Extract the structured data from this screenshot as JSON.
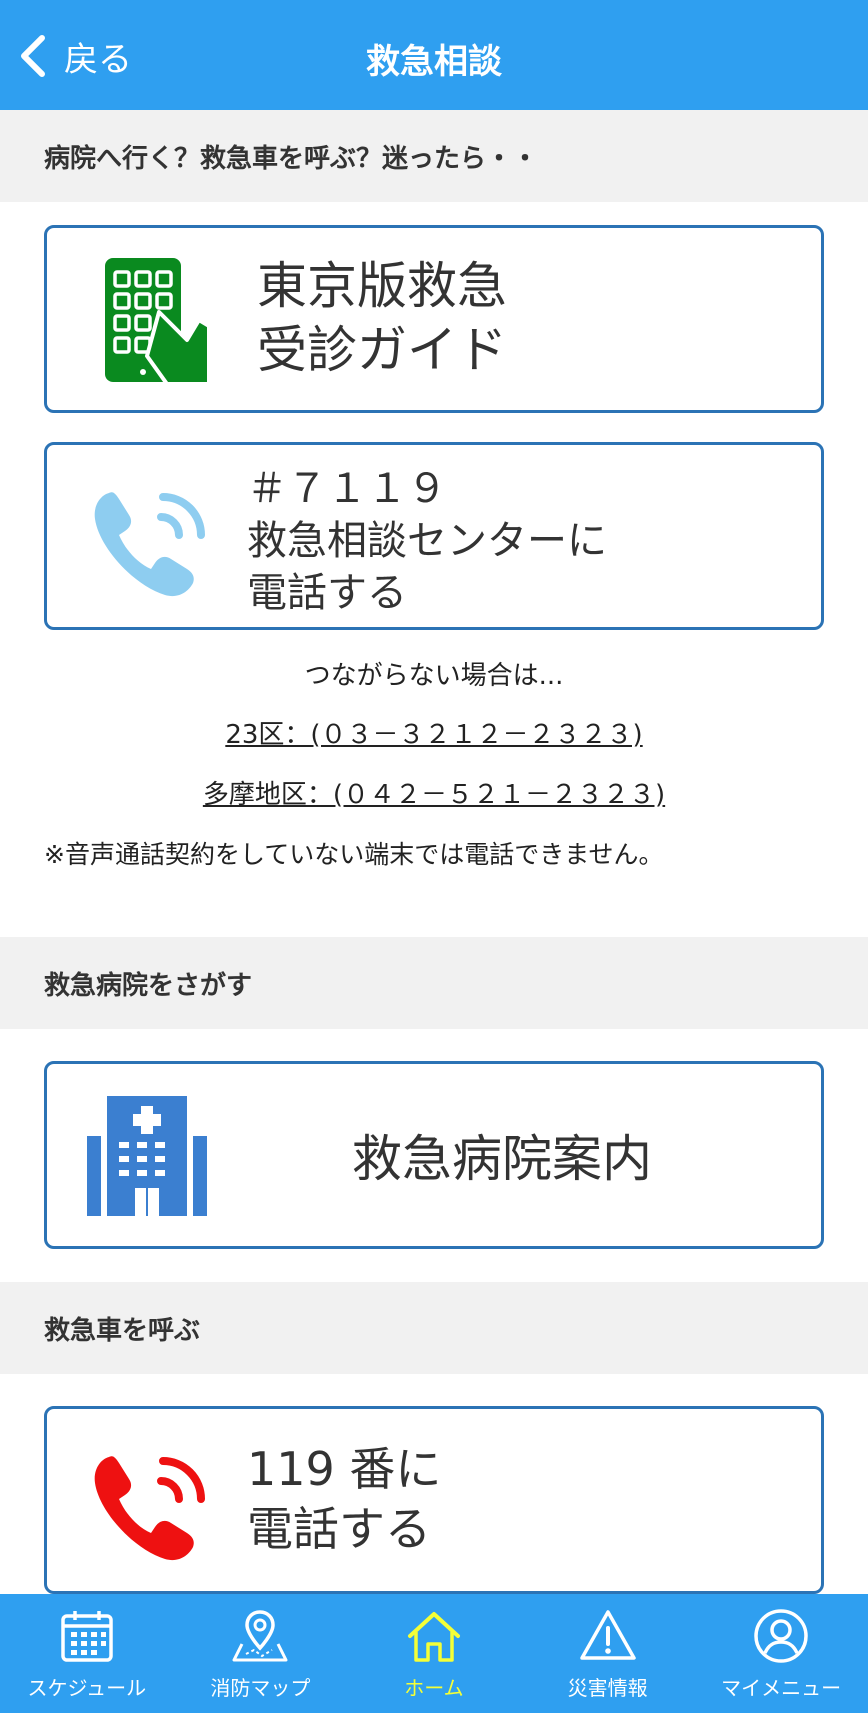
{
  "header": {
    "back_label": "戻る",
    "title": "救急相談"
  },
  "sections": {
    "consult": "病院へ行く？救急車を呼ぶ？迷ったら・・",
    "hospital": "救急病院をさがす",
    "ambulance": "救急車を呼ぶ"
  },
  "cards": {
    "guide": {
      "line1": "東京版救急",
      "line2": "受診ガイド",
      "icon": "tablet-hand-icon"
    },
    "c7119": {
      "line1": "＃７１１９",
      "line2": "救急相談センターに",
      "line3": "電話する",
      "icon": "phone-call-icon"
    },
    "hospital": {
      "label": "救急病院案内",
      "icon": "hospital-building-icon"
    },
    "c119": {
      "line1": "119 番に",
      "line2": "電話する",
      "icon": "phone-call-icon"
    }
  },
  "notes": {
    "fallback": "つながらない場合は...",
    "ward23": "23区：(０３－３２１２－２３２３)",
    "tama": "多摩地区：(０４２－５２１－２３２３)",
    "warning": "※音声通話契約をしていない端末では電話できません。"
  },
  "tabs": [
    {
      "label": "スケジュール",
      "icon": "calendar-icon"
    },
    {
      "label": "消防マップ",
      "icon": "map-pin-icon"
    },
    {
      "label": "ホーム",
      "icon": "home-icon"
    },
    {
      "label": "災害情報",
      "icon": "warning-icon"
    },
    {
      "label": "マイメニュー",
      "icon": "user-icon"
    }
  ],
  "colors": {
    "header": "#2f9ff0",
    "card_border": "#2b73b5",
    "guide_icon": "#0a8a1f",
    "phone_light": "#8ecdf0",
    "hospital_icon": "#3b7fd0",
    "phone_red": "#ee1111",
    "tab_active": "#f4ff37"
  }
}
